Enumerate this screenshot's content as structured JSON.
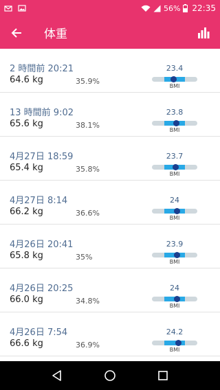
{
  "status_bar": {
    "battery": "56%",
    "time": "22:35"
  },
  "app_bar": {
    "title": "体重"
  },
  "entries": [
    {
      "time": "2 時間前 20:21",
      "weight": "64.6 kg",
      "fat": "35.9%",
      "bmi": "23.4",
      "bmi_label": "BMI",
      "bmi_position": 0.48
    },
    {
      "time": "13 時間前 9:02",
      "weight": "65.6 kg",
      "fat": "38.1%",
      "bmi": "23.8",
      "bmi_label": "BMI",
      "bmi_position": 0.54
    },
    {
      "time": "4月27日 18:59",
      "weight": "65.4 kg",
      "fat": "35.8%",
      "bmi": "23.7",
      "bmi_label": "BMI",
      "bmi_position": 0.53
    },
    {
      "time": "4月27日 8:14",
      "weight": "66.2 kg",
      "fat": "36.6%",
      "bmi": "24",
      "bmi_label": "BMI",
      "bmi_position": 0.56
    },
    {
      "time": "4月26日 20:41",
      "weight": "65.8 kg",
      "fat": "35%",
      "bmi": "23.9",
      "bmi_label": "BMI",
      "bmi_position": 0.55
    },
    {
      "time": "4月26日 20:25",
      "weight": "66.0 kg",
      "fat": "34.8%",
      "bmi": "24",
      "bmi_label": "BMI",
      "bmi_position": 0.56
    },
    {
      "time": "4月26日 7:54",
      "weight": "66.6 kg",
      "fat": "36.9%",
      "bmi": "24.2",
      "bmi_label": "BMI",
      "bmi_position": 0.59
    },
    {
      "time": "",
      "weight": "",
      "fat": "",
      "bmi": "",
      "bmi_label": "",
      "bmi_position": null
    }
  ],
  "colors": {
    "accent": "#e8336d",
    "bmi_normal_range": "#29a9e6",
    "bmi_marker": "#1b3f8f",
    "time_text": "#4f6c91"
  },
  "icons": {
    "back": "arrow-left-icon",
    "chart": "bar-chart-icon",
    "nav_back": "triangle-back-icon",
    "nav_home": "circle-home-icon",
    "nav_recent": "square-recents-icon"
  }
}
